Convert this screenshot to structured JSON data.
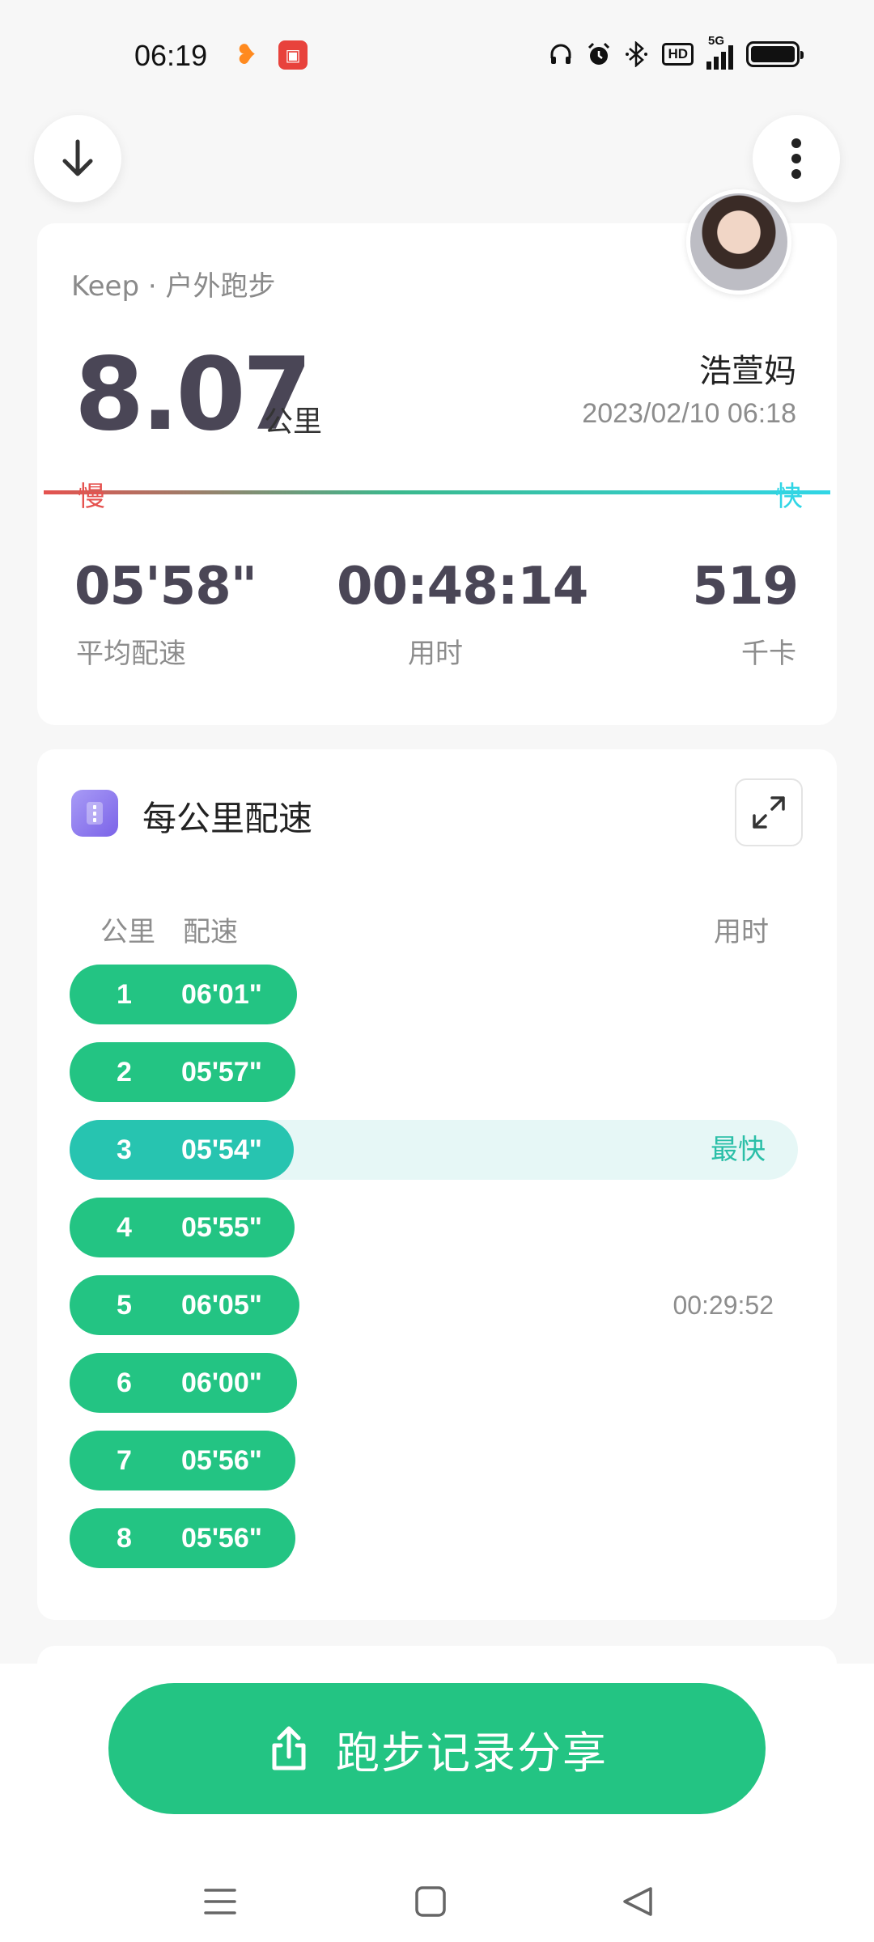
{
  "status_bar": {
    "time": "06:19",
    "network": "5G",
    "hd": "HD"
  },
  "summary": {
    "brand": "Keep · 户外跑步",
    "distance": "8.07",
    "distance_unit": "公里",
    "user_name": "浩萱妈",
    "datetime": "2023/02/10 06:18",
    "slow_label": "慢",
    "fast_label": "快",
    "avg_pace": "05'58\"",
    "avg_pace_label": "平均配速",
    "duration": "00:48:14",
    "duration_label": "用时",
    "calories": "519",
    "calories_label": "千卡"
  },
  "splits": {
    "title": "每公里配速",
    "col_km": "公里",
    "col_pace": "配速",
    "col_time": "用时",
    "rows": [
      {
        "km": "1",
        "pace": "06'01\"",
        "fill": 0.312
      },
      {
        "km": "2",
        "pace": "05'57\"",
        "fill": 0.31
      },
      {
        "km": "3",
        "pace": "05'54\"",
        "fill": 0.308,
        "tag": "最快",
        "fastest": true
      },
      {
        "km": "4",
        "pace": "05'55\"",
        "fill": 0.309
      },
      {
        "km": "5",
        "pace": "06'05\"",
        "fill": 0.315,
        "cum_time": "00:29:52"
      },
      {
        "km": "6",
        "pace": "06'00\"",
        "fill": 0.312
      },
      {
        "km": "7",
        "pace": "05'56\"",
        "fill": 0.31
      },
      {
        "km": "8",
        "pace": "05'56\"",
        "fill": 0.31
      }
    ]
  },
  "share": {
    "label": "跑步记录分享"
  },
  "colors": {
    "accent": "#23c483",
    "fastest": "#27c4b0",
    "slow": "#e5524f",
    "fast": "#31d6e6"
  }
}
